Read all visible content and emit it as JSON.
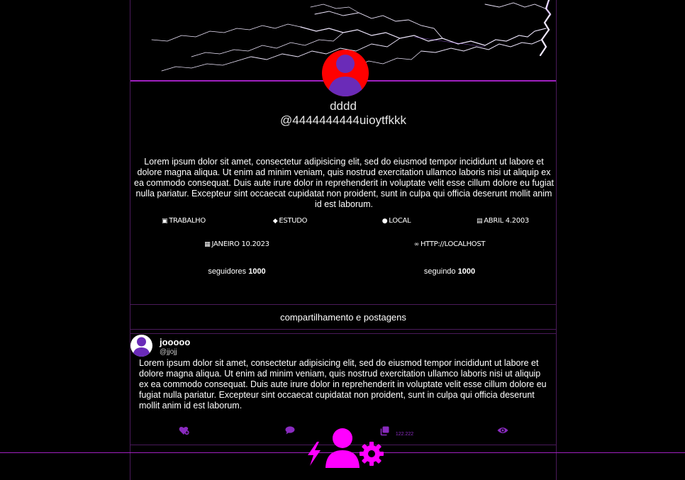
{
  "profile": {
    "display_name": "dddd",
    "handle": "@4444444444uioytfkkk",
    "bio": "Lorem ipsum dolor sit amet, consectetur adipisicing elit, sed do eiusmod tempor incididunt ut labore et dolore magna aliqua. Ut enim ad minim veniam, quis nostrud exercitation ullamco laboris nisi ut aliquip ex ea commodo consequat. Duis aute irure dolor in reprehenderit in voluptate velit esse cillum dolore eu fugiat nulla pariatur. Excepteur sint occaecat cupidatat non proident, sunt in culpa qui officia deserunt mollit anim id est laborum.",
    "avatar_color": "#ff0000",
    "avatar_figure_color": "#6a2bb8",
    "work": "TRABALHO",
    "study": "ESTUDO",
    "location": "LOCAL",
    "birthday": "ABRIL 4.2003",
    "joined": "JANEIRO 10.2023",
    "link": "HTTP://LOCALHOST",
    "followers_label": "seguidores",
    "followers_count": "1000",
    "following_label": "seguindo",
    "following_count": "1000"
  },
  "icons": {
    "work": "briefcase-icon",
    "study": "graduation-cap-icon",
    "location": "map-pin-icon",
    "birthday": "cake-icon",
    "joined": "id-card-icon",
    "link": "link-icon"
  },
  "feed": {
    "header": "compartilhamento e postagens",
    "posts": [
      {
        "author": "jooooo",
        "username": "@jjojj",
        "body": "Lorem ipsum dolor sit amet, consectetur adipisicing elit, sed do eiusmod tempor incididunt ut labore et dolore magna aliqua. Ut enim ad minim veniam, quis nostrud exercitation ullamco laboris nisi ut aliquip ex ea commodo consequat. Duis aute irure dolor in reprehenderit in voluptate velit esse cillum dolore eu fugiat nulla pariatur. Excepteur sint occaecat cupidatat non proident, sunt in culpa qui officia deserunt mollit anim id est laborum.",
        "share_count": "122.222"
      }
    ]
  },
  "colors": {
    "accent": "#a020c0",
    "nav_accent": "#ff00ff",
    "action_icon": "#8a2bc0",
    "border": "#4a1a5a"
  }
}
